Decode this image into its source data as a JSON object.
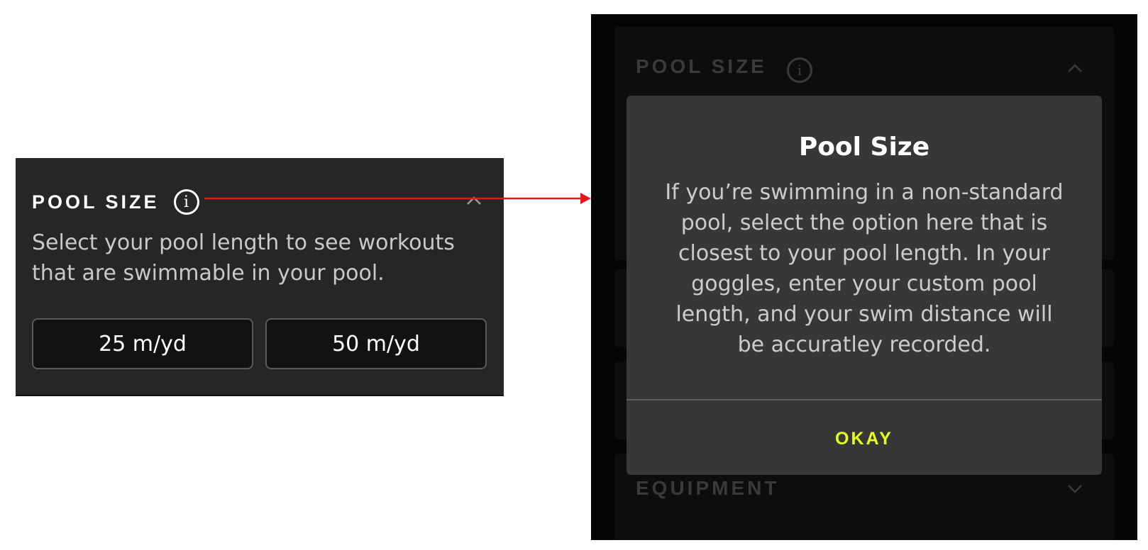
{
  "left_card": {
    "title": "POOL SIZE",
    "info_icon": "info-icon",
    "collapse_icon": "chevron-up-icon",
    "description": "Select your pool length to see workouts that are swimmable in your pool.",
    "options": [
      "25 m/yd",
      "50 m/yd"
    ]
  },
  "annotation": {
    "arrow_color": "#e8161b"
  },
  "right_screen": {
    "background_sections": [
      {
        "title": "POOL SIZE",
        "icon": "chevron-up-icon"
      },
      {
        "title": "EQUIPMENT",
        "icon": "chevron-down-icon"
      }
    ],
    "modal": {
      "title": "Pool Size",
      "body": "If you’re swimming in a non-standard pool, select the option here that is closest to your pool length. In your goggles, enter your custom pool length, and your swim distance will be accuratley recorded.",
      "okay_label": "OKAY",
      "accent_color": "#e4ff1a"
    }
  }
}
